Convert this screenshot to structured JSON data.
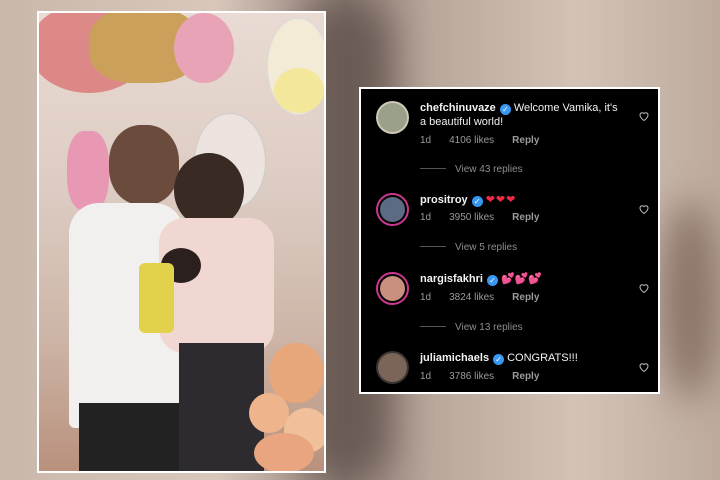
{
  "comments": [
    {
      "username": "chefchinuvaze",
      "text": "Welcome Vamika, it's",
      "text2": "a beautiful world!",
      "time": "1d",
      "likes": "4106 likes",
      "reply": "Reply",
      "view_replies": "View 43 replies"
    },
    {
      "username": "prositroy",
      "text": "❤❤❤",
      "time": "1d",
      "likes": "3950 likes",
      "reply": "Reply",
      "view_replies": "View 5 replies"
    },
    {
      "username": "nargisfakhri",
      "text": "💕💕💕",
      "time": "1d",
      "likes": "3824 likes",
      "reply": "Reply",
      "view_replies": "View 13 replies"
    },
    {
      "username": "juliamichaels",
      "text": "CONGRATS!!!",
      "time": "1d",
      "likes": "3786 likes",
      "reply": "Reply"
    }
  ],
  "icons": {
    "verified": "verified-badge-icon",
    "like": "heart-outline-icon"
  },
  "colors": {
    "panel_bg": "#000000",
    "verified": "#3897f0",
    "story_ring": "#c8388c"
  }
}
